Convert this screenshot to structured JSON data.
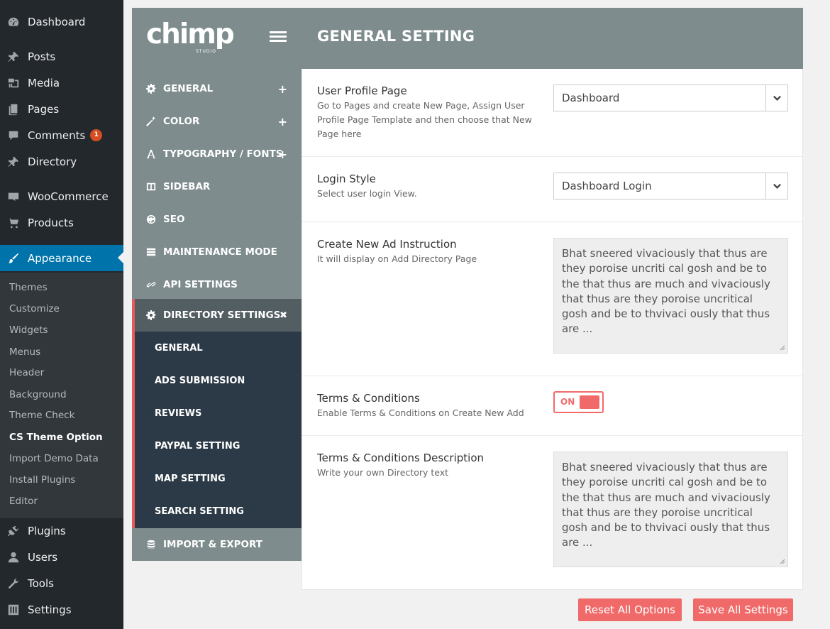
{
  "wp_menu": {
    "items": [
      {
        "label": "Dashboard",
        "icon": "dashboard-icon"
      },
      {
        "label": "Posts",
        "icon": "pin-icon"
      },
      {
        "label": "Media",
        "icon": "media-icon"
      },
      {
        "label": "Pages",
        "icon": "pages-icon"
      },
      {
        "label": "Comments",
        "icon": "comment-icon",
        "badge": "1"
      },
      {
        "label": "Directory",
        "icon": "pin-icon"
      },
      {
        "label": "WooCommerce",
        "icon": "woo-icon"
      },
      {
        "label": "Products",
        "icon": "cart-icon"
      },
      {
        "label": "Appearance",
        "icon": "brush-icon"
      },
      {
        "label": "Plugins",
        "icon": "plug-icon"
      },
      {
        "label": "Users",
        "icon": "user-icon"
      },
      {
        "label": "Tools",
        "icon": "wrench-icon"
      },
      {
        "label": "Settings",
        "icon": "settings-icon"
      }
    ],
    "submenu": [
      "Themes",
      "Customize",
      "Widgets",
      "Menus",
      "Header",
      "Background",
      "Theme Check",
      "CS Theme Option",
      "Import Demo Data",
      "Install Plugins",
      "Editor"
    ]
  },
  "header": {
    "logo": "chimp",
    "logo_sub": "STUDIO",
    "title": "GENERAL SETTING"
  },
  "nav": {
    "items": [
      {
        "label": "GENERAL",
        "icon": "gear-icon",
        "toggle": "+"
      },
      {
        "label": "COLOR",
        "icon": "wand-icon",
        "toggle": "+"
      },
      {
        "label": "TYPOGRAPHY / FONTS",
        "icon": "font-icon",
        "toggle": "+"
      },
      {
        "label": "SIDEBAR",
        "icon": "columns-icon",
        "toggle": ""
      },
      {
        "label": "SEO",
        "icon": "globe-icon",
        "toggle": ""
      },
      {
        "label": "MAINTENANCE MODE",
        "icon": "server-icon",
        "toggle": ""
      },
      {
        "label": "API SETTINGS",
        "icon": "link-icon",
        "toggle": ""
      },
      {
        "label": "DIRECTORY SETTINGS",
        "icon": "gear-icon",
        "toggle": "✖"
      },
      {
        "label": "IMPORT & EXPORT",
        "icon": "database-icon",
        "toggle": ""
      }
    ],
    "directory_sub": [
      "GENERAL",
      "ADS SUBMISSION",
      "REVIEWS",
      "PAYPAL SETTING",
      "MAP SETTING",
      "SEARCH SETTING"
    ]
  },
  "content": {
    "user_profile": {
      "title": "User Profile Page",
      "desc": "Go to Pages and create New Page, Assign User Profile Page Template and then choose that New Page here",
      "value": "Dashboard"
    },
    "login_style": {
      "title": "Login Style",
      "desc": "Select user login View.",
      "value": "Dashboard Login"
    },
    "ad_instruction": {
      "title": "Create New Ad Instruction",
      "desc": "It will display on Add Directory Page",
      "value": "Bhat sneered vivaciously that thus are they poroise uncriti cal gosh and be to the that thus are much and vivaciously that thus are they poroise uncritical gosh and be to thvivaci ously that thus are ..."
    },
    "terms": {
      "title": "Terms & Conditions",
      "desc": "Enable Terms & Conditions on Create New Add",
      "toggle_label": "ON"
    },
    "terms_desc": {
      "title": "Terms & Conditions Description",
      "desc": "Write your own Directory text",
      "value": "Bhat sneered vivaciously that thus are they poroise uncriti cal gosh and be to the that thus are much and vivaciously that thus are they poroise uncritical gosh and be to thvivaci ously that thus are ..."
    }
  },
  "buttons": {
    "reset": "Reset All Options",
    "save": "Save All Settings"
  },
  "colors": {
    "wp_sidebar": "#23282d",
    "wp_active": "#0073aa",
    "panel_gray": "#7e8c8d",
    "submenu_dark": "#2c3a47",
    "accent_red": "#f16a6a"
  }
}
